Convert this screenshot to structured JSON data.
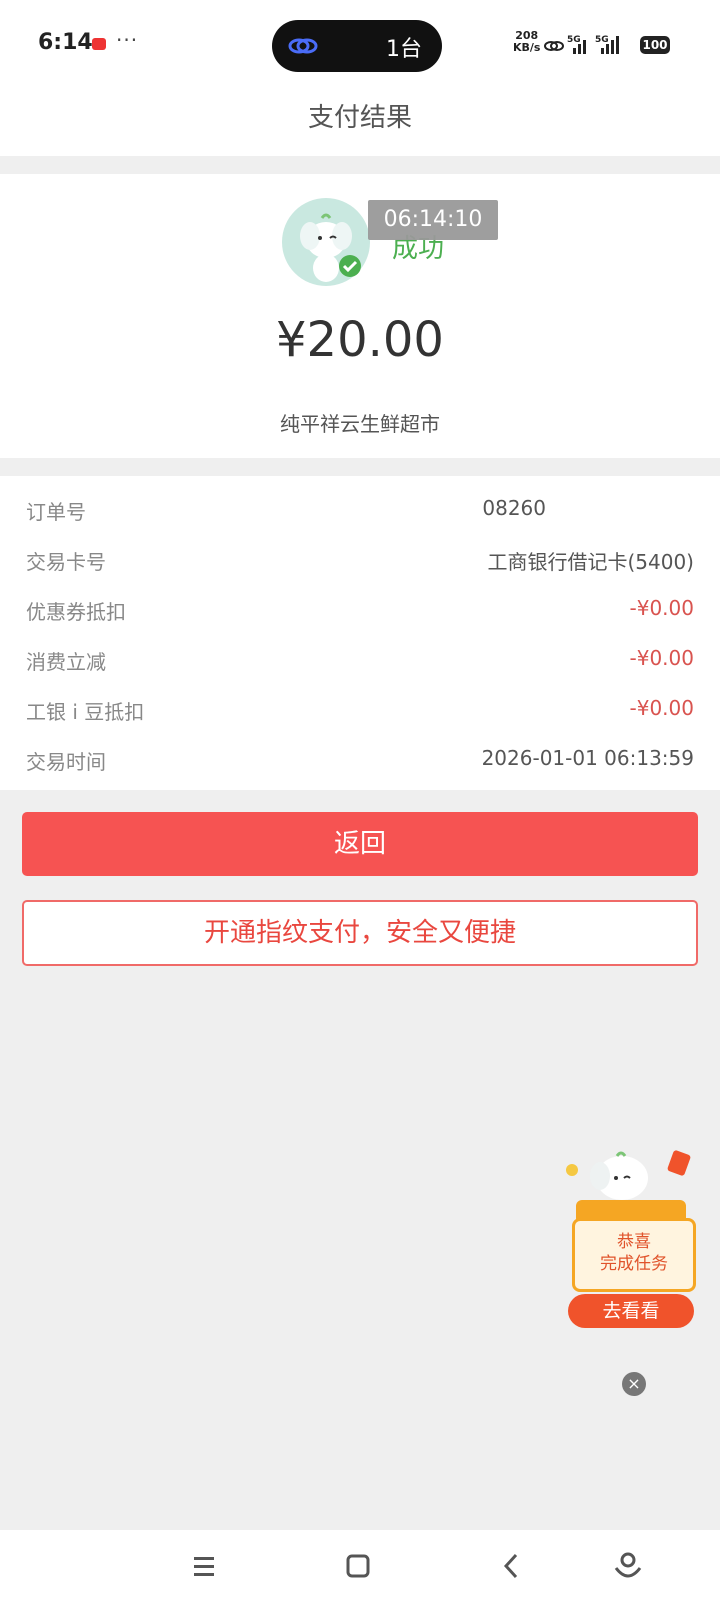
{
  "status_bar": {
    "time": "6:14",
    "more": "···",
    "island_text": "1台",
    "net_speed_value": "208",
    "net_speed_unit": "KB/s",
    "battery": "100",
    "network_label": "5G"
  },
  "header": {
    "title": "支付结果"
  },
  "result": {
    "time_badge": "06:14:10",
    "status": "成功",
    "amount": "¥20.00",
    "merchant": "纯平祥云生鲜超市",
    "status_color": "#4caf50"
  },
  "details": [
    {
      "label": "订单号",
      "value": "08260",
      "red": false
    },
    {
      "label": "交易卡号",
      "value": "工商银行借记卡(5400)",
      "red": false
    },
    {
      "label": "优惠券抵扣",
      "value": "-¥0.00",
      "red": true
    },
    {
      "label": "消费立减",
      "value": "-¥0.00",
      "red": true
    },
    {
      "label": "工银 i 豆抵扣",
      "value": "-¥0.00",
      "red": true
    },
    {
      "label": "交易时间",
      "value": "2026-01-01 06:13:59",
      "red": false
    }
  ],
  "buttons": {
    "back_label": "返回",
    "fingerprint_label": "开通指纹支付，安全又便捷",
    "primary_color": "#f65352"
  },
  "promo": {
    "line1": "恭喜",
    "line2": "完成任务",
    "action": "去看看",
    "close": "×"
  },
  "nav": {
    "icons": [
      "menu-icon",
      "home-icon",
      "back-icon",
      "assistant-icon"
    ]
  }
}
